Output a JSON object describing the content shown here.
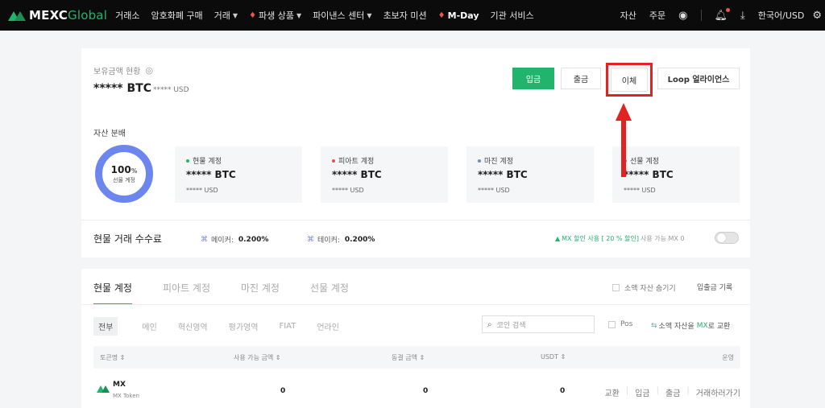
{
  "nav": {
    "logo_prefix": "MEXC",
    "logo_suffix": "Global",
    "items": [
      {
        "label": "거래소",
        "caret": false,
        "fire": false,
        "bold": false
      },
      {
        "label": "암호화폐 구매",
        "caret": false,
        "fire": false,
        "bold": false
      },
      {
        "label": "거래",
        "caret": true,
        "fire": false,
        "bold": false
      },
      {
        "label": "파생 상품",
        "caret": true,
        "fire": true,
        "bold": false
      },
      {
        "label": "파이낸스 센터",
        "caret": true,
        "fire": false,
        "bold": false
      },
      {
        "label": "초보자 미션",
        "caret": false,
        "fire": false,
        "bold": false
      },
      {
        "label": "M-Day",
        "caret": false,
        "fire": true,
        "bold": true
      },
      {
        "label": "기관 서비스",
        "caret": false,
        "fire": false,
        "bold": false
      }
    ],
    "right": {
      "assets": "자산",
      "orders": "주문",
      "lang": "한국어/USD"
    }
  },
  "overview": {
    "balance_label": "보유금액 현황",
    "balance_value": "***** BTC",
    "balance_usd": "***** USD",
    "buttons": {
      "deposit": "입금",
      "withdraw": "출금",
      "transfer": "이체",
      "loop": "Loop 얼라이언스"
    },
    "distribution_label": "자산 분배",
    "donut": {
      "percent": "100",
      "percent_sign": "%",
      "label": "선물 계정",
      "value": 100
    },
    "accounts": [
      {
        "name": "현물 계정",
        "value": "***** BTC",
        "usd": "***** USD",
        "dot": "#21b46c"
      },
      {
        "name": "피아트 계정",
        "value": "***** BTC",
        "usd": "***** USD",
        "dot": "#e05252"
      },
      {
        "name": "마진 계정",
        "value": "***** BTC",
        "usd": "***** USD",
        "dot": "#6c86f0"
      },
      {
        "name": "선물 계정",
        "value": "***** BTC",
        "usd": "***** USD",
        "dot": "#6c86f0"
      }
    ],
    "fees": {
      "title": "현물 거래 수수료",
      "maker_label": "메이커:",
      "maker_value": "0.200%",
      "taker_label": "테이커:",
      "taker_value": "0.200%",
      "mx_prefix": "MX 할인 사용 [",
      "mx_pct": "20 %",
      "mx_suffix": "할인]",
      "mx_muted": "사용 가능 MX 0"
    }
  },
  "wallet": {
    "tabs": [
      "현물 계정",
      "피아트 계정",
      "마진 계정",
      "선물 계정"
    ],
    "hide_small": "소액 자산 숨기기",
    "deposit_history": "입출금 기록",
    "filters": [
      "전부",
      "메인",
      "혁신영역",
      "평가영역",
      "FIAT",
      "언라인"
    ],
    "search_placeholder": "코인 검색",
    "pos_label": "Pos",
    "convert_prefix": "소액 자산을",
    "convert_mx": "MX",
    "convert_suffix": "로 교환",
    "columns": {
      "token": "토큰명 ⇕",
      "available": "사용 가능 금액 ⇕",
      "frozen": "동결 금액 ⇕",
      "usdt": "USDT ⇕",
      "ops": "운영"
    },
    "rows": [
      {
        "symbol": "MX",
        "name": "MX Token",
        "available": "0",
        "frozen": "0",
        "usdt": "0",
        "actions": [
          "교환",
          "입금",
          "출금",
          "거래하러가기"
        ]
      }
    ]
  },
  "colors": {
    "brand": "#21b46c",
    "annotation": "#e32222",
    "donut": "#6c86f0"
  }
}
